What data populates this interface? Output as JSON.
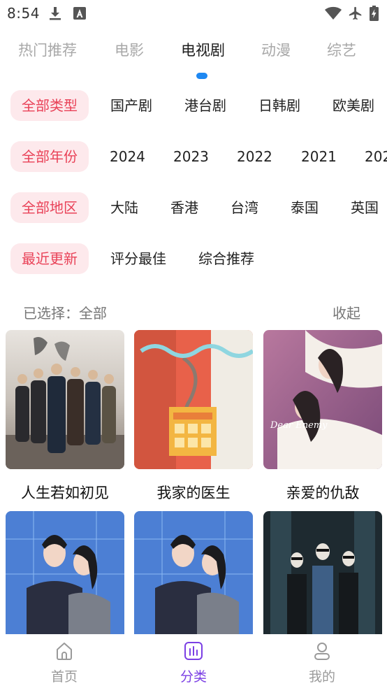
{
  "status_bar": {
    "time": "8:54",
    "icons": [
      "download-icon",
      "text-a-icon",
      "wifi-icon",
      "airplane-icon",
      "battery-charging-icon"
    ]
  },
  "tabs": [
    {
      "label": "热门推荐",
      "active": false
    },
    {
      "label": "电影",
      "active": false
    },
    {
      "label": "电视剧",
      "active": true
    },
    {
      "label": "动漫",
      "active": false
    },
    {
      "label": "综艺",
      "active": false
    }
  ],
  "filters": {
    "type": {
      "selected": "全部类型",
      "options": [
        "国产剧",
        "港台剧",
        "日韩剧",
        "欧美剧"
      ]
    },
    "year": {
      "selected": "全部年份",
      "options": [
        "2024",
        "2023",
        "2022",
        "2021",
        "202"
      ]
    },
    "region": {
      "selected": "全部地区",
      "options": [
        "大陆",
        "香港",
        "台湾",
        "泰国",
        "英国"
      ]
    },
    "sort": {
      "selected": "最近更新",
      "options": [
        "评分最佳",
        "综合推荐"
      ]
    }
  },
  "selection": {
    "text": "已选择：全部",
    "collapse_label": "收起"
  },
  "grid": [
    {
      "title": "人生若如初见"
    },
    {
      "title": "我家的医生"
    },
    {
      "title": "亲爱的仇敌"
    },
    {
      "title": ""
    },
    {
      "title": ""
    },
    {
      "title": ""
    }
  ],
  "bottom_nav": [
    {
      "label": "首页",
      "icon": "home-icon",
      "active": false
    },
    {
      "label": "分类",
      "icon": "category-icon",
      "active": true
    },
    {
      "label": "我的",
      "icon": "profile-icon",
      "active": false
    }
  ],
  "colors": {
    "accent_tab": "#1e88f2",
    "chip_bg": "#fde9ec",
    "chip_text": "#e94258",
    "nav_active": "#7b3fe4"
  }
}
